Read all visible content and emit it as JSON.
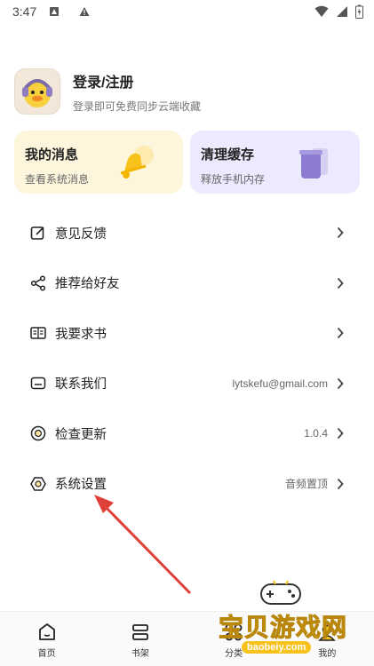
{
  "status_bar": {
    "time": "3:47"
  },
  "profile": {
    "title": "登录/注册",
    "subtitle": "登录即可免费同步云端收藏"
  },
  "cards": [
    {
      "title": "我的消息",
      "subtitle": "查看系统消息"
    },
    {
      "title": "清理缓存",
      "subtitle": "释放手机内存"
    }
  ],
  "menu": [
    {
      "label": "意见反馈",
      "value": ""
    },
    {
      "label": "推荐给好友",
      "value": ""
    },
    {
      "label": "我要求书",
      "value": ""
    },
    {
      "label": "联系我们",
      "value": "lytskefu@gmail.com"
    },
    {
      "label": "检查更新",
      "value": "1.0.4"
    },
    {
      "label": "系统设置",
      "value": "音频置顶"
    }
  ],
  "tabbar": [
    {
      "label": "首页"
    },
    {
      "label": "书架"
    },
    {
      "label": "分类"
    },
    {
      "label": "我的"
    }
  ],
  "watermark": {
    "text": "宝贝游戏网",
    "url": "baobeiy.com"
  },
  "colors": {
    "accent_yellow": "#fdf6dd",
    "accent_purple": "#eceaff",
    "arrow": "#e0403a"
  }
}
